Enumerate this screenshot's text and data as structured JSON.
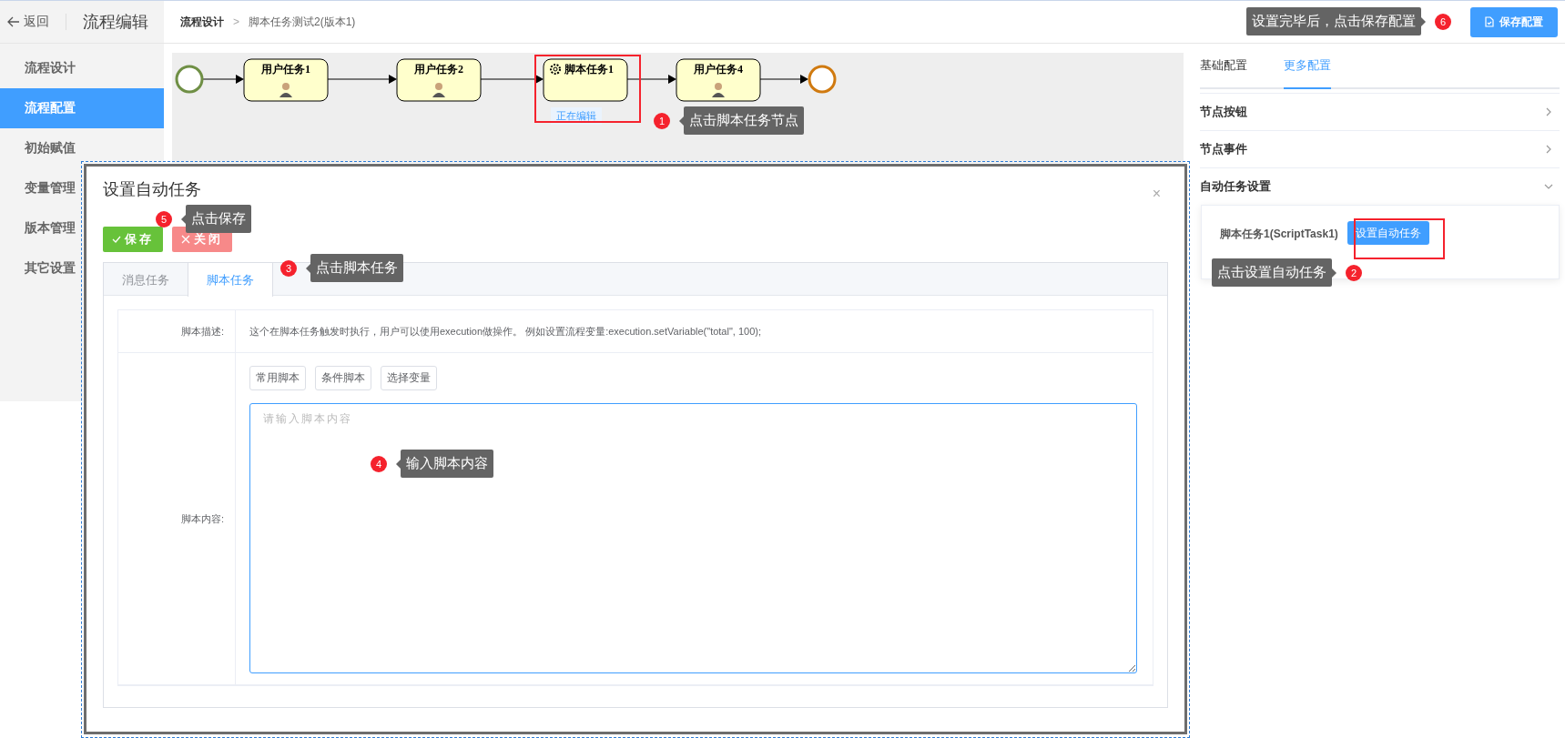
{
  "header": {
    "back_label": "返回",
    "title": "流程编辑",
    "breadcrumb": [
      "流程设计",
      "脚本任务测试2(版本1)"
    ],
    "breadcrumb_separator": ">",
    "save_button": "保存配置"
  },
  "sidebar": {
    "items": [
      {
        "label": "流程设计",
        "selected": false
      },
      {
        "label": "流程配置",
        "selected": true
      },
      {
        "label": "初始赋值",
        "selected": false
      },
      {
        "label": "变量管理",
        "selected": false
      },
      {
        "label": "版本管理",
        "selected": false
      },
      {
        "label": "其它设置",
        "selected": false
      }
    ]
  },
  "diagram": {
    "nodes": [
      {
        "kind": "start"
      },
      {
        "kind": "user_task",
        "label": "用户任务1"
      },
      {
        "kind": "user_task",
        "label": "用户任务2"
      },
      {
        "kind": "script_task",
        "label": "脚本任务1",
        "status": "正在编辑"
      },
      {
        "kind": "user_task",
        "label": "用户任务4"
      },
      {
        "kind": "end"
      }
    ]
  },
  "right_panel": {
    "tabs": [
      {
        "label": "基础配置",
        "selected": false
      },
      {
        "label": "更多配置",
        "selected": true
      }
    ],
    "sections": [
      {
        "title": "节点按钮",
        "expanded": false
      },
      {
        "title": "节点事件",
        "expanded": false
      },
      {
        "title": "自动任务设置",
        "expanded": true
      }
    ],
    "auto_task": {
      "name": "脚本任务1(ScriptTask1)",
      "button": "设置自动任务"
    }
  },
  "dialog": {
    "title": "设置自动任务",
    "close": "×",
    "buttons": [
      {
        "kind": "save",
        "label": "保存"
      },
      {
        "kind": "close",
        "label": "关闭"
      }
    ],
    "tabs": [
      {
        "label": "消息任务",
        "selected": false
      },
      {
        "label": "脚本任务",
        "selected": true
      }
    ],
    "description_label": "脚本描述:",
    "description": "这个在脚本任务触发时执行，用户可以使用execution做操作。 例如设置流程变量:execution.setVariable(\"total\", 100);",
    "content_label": "脚本内容:",
    "script_buttons": [
      "常用脚本",
      "条件脚本",
      "选择变量"
    ],
    "placeholder": "请输入脚本内容"
  },
  "annotations": [
    {
      "number": "6",
      "text": "设置完毕后，点击保存配置"
    },
    {
      "number": "1",
      "text": "点击脚本任务节点"
    },
    {
      "number": "5",
      "text": "点击保存"
    },
    {
      "number": "3",
      "text": "点击脚本任务"
    },
    {
      "number": "2",
      "text": "点击设置自动任务"
    },
    {
      "number": "4",
      "text": "输入脚本内容"
    }
  ]
}
